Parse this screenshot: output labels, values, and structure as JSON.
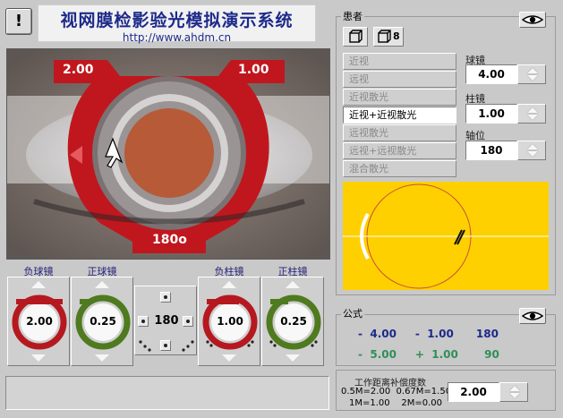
{
  "header": {
    "info_label": "!",
    "title": "视网膜检影验光模拟演示系统",
    "url": "http://www.ahdm.cn"
  },
  "eye_view": {
    "left_power": "2.00",
    "right_power": "1.00",
    "axis_label": "180o"
  },
  "lenses": {
    "neg_sphere_label": "负球镜",
    "pos_sphere_label": "正球镜",
    "neg_cyl_label": "负柱镜",
    "pos_cyl_label": "正柱镜",
    "neg_sphere_value": "2.00",
    "pos_sphere_value": "0.25",
    "neg_cyl_value": "1.00",
    "pos_cyl_value": "0.25",
    "axis_value": "180"
  },
  "patient": {
    "title": "患者",
    "view_count": "8",
    "types": [
      "近视",
      "远视",
      "近视散光",
      "近视+近视散光",
      "远视散光",
      "远视+远视散光",
      "混合散光"
    ],
    "selected_index": 3,
    "sphere_label": "球镜",
    "sphere_value": "4.00",
    "cyl_label": "柱镜",
    "cyl_value": "1.00",
    "axis_label": "轴位",
    "axis_value": "180"
  },
  "formula": {
    "title": "公式",
    "row1": {
      "s1": "-",
      "v1": "4.00",
      "s2": "-",
      "v2": "1.00",
      "v3": "180"
    },
    "row2": {
      "s1": "-",
      "v1": "5.00",
      "s2": "+",
      "v2": "1.00",
      "v3": "90"
    }
  },
  "workdist": {
    "title": "工作距离补偿度数",
    "line1": "0.5M=2.00  0.67M=1.50",
    "line2": "1M=1.00    2M=0.00",
    "value": "2.00"
  },
  "colors": {
    "ring_red": "#c0171e",
    "iris": "#b65a38",
    "lens_green": "#4f7a1f",
    "formula_blue": "#1d2a8a",
    "formula_green": "#2f8f5a",
    "retina_bg": "#ffd000"
  }
}
